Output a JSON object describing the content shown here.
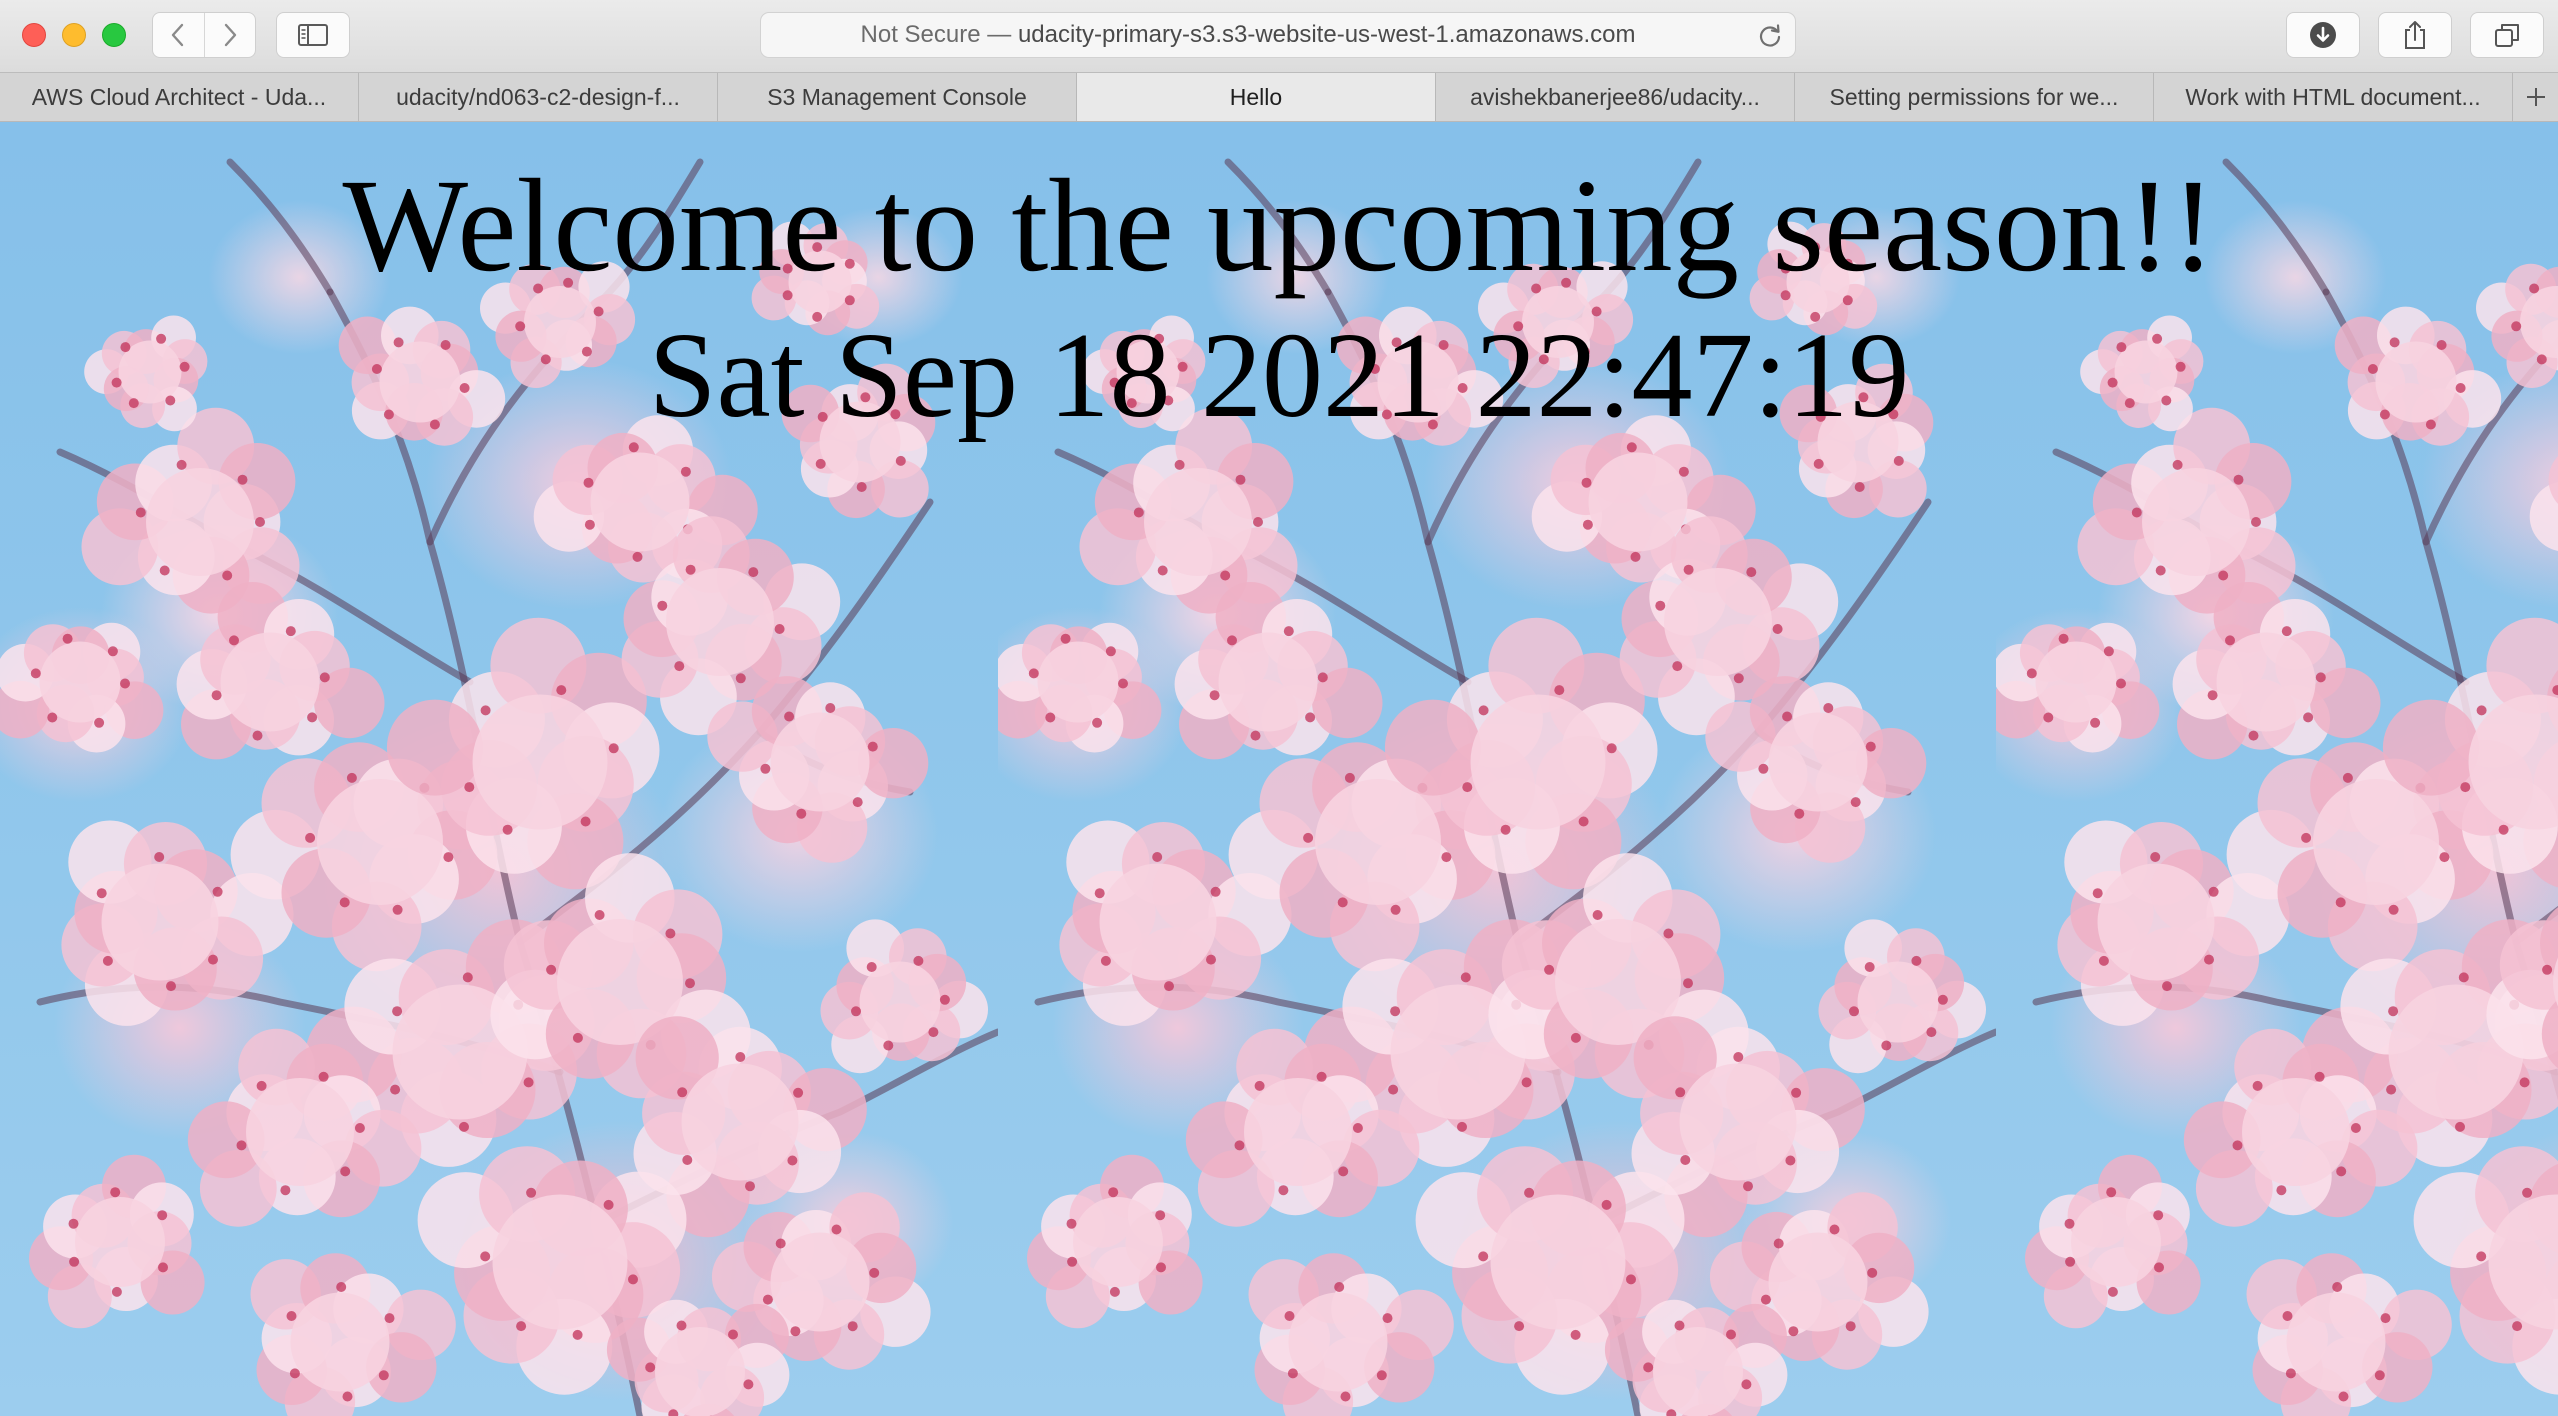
{
  "window": {
    "address_bar": {
      "security_label": "Not Secure —",
      "url": "udacity-primary-s3.s3-website-us-west-1.amazonaws.com"
    },
    "toolbar_icons": [
      "back-icon",
      "forward-icon",
      "sidebar-icon",
      "reload-icon",
      "download-icon",
      "share-icon",
      "tab-overview-icon"
    ]
  },
  "tabs": [
    {
      "label": "AWS Cloud Architect - Uda..."
    },
    {
      "label": "udacity/nd063-c2-design-f..."
    },
    {
      "label": "S3 Management Console"
    },
    {
      "label": "Hello"
    },
    {
      "label": "avishekbanerjee86/udacity..."
    },
    {
      "label": "Setting permissions for we..."
    },
    {
      "label": "Work with HTML document..."
    }
  ],
  "active_tab_index": 3,
  "page": {
    "headline": "Welcome to the upcoming season!!",
    "datetime": "Sat Sep 18 2021 22:47:19",
    "background": "repeating cherry blossom image",
    "colors": {
      "sky": "#8ec3e8",
      "blossom": "#f4c4d6",
      "text": "#000000"
    }
  }
}
